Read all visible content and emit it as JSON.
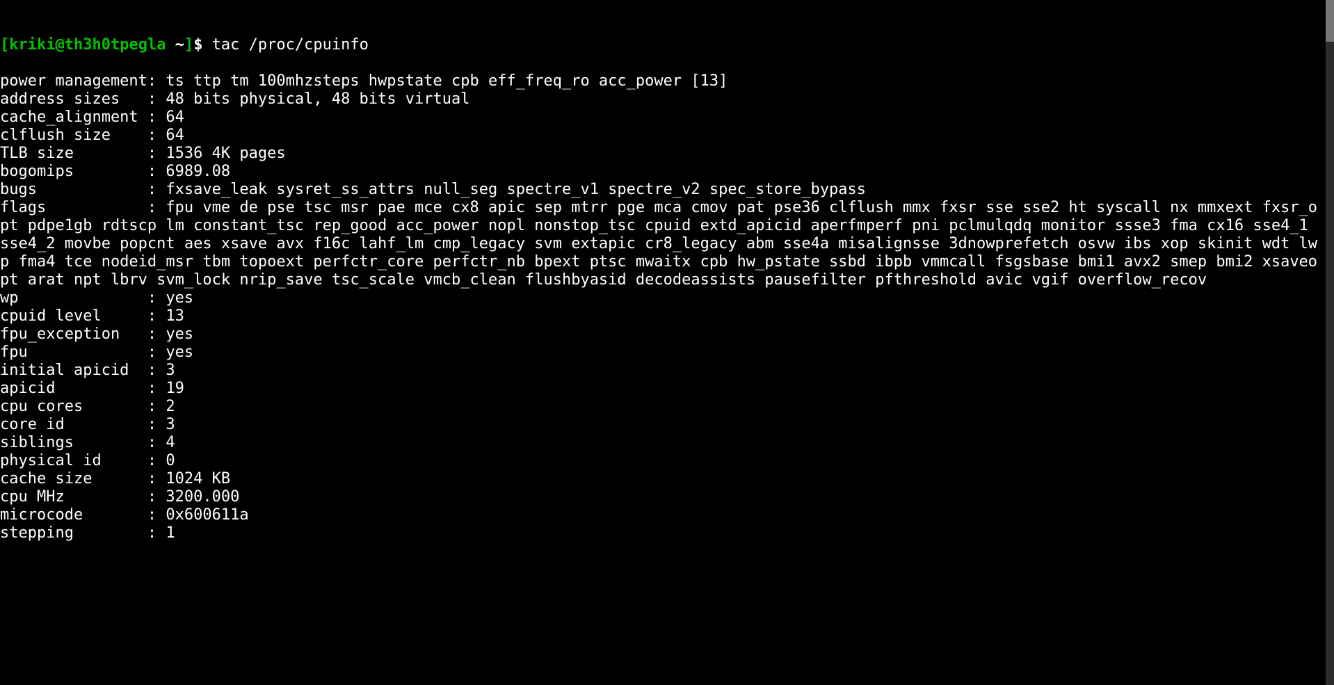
{
  "prompt": {
    "open": "[",
    "user": "kriki",
    "at": "@",
    "host": "th3h0tpegla",
    "space1": " ",
    "path": "~",
    "close": "]",
    "dollar": "$",
    "space2": " "
  },
  "command": "tac /proc/cpuinfo",
  "blank_after_command": "",
  "lines": [
    "power management: ts ttp tm 100mhzsteps hwpstate cpb eff_freq_ro acc_power [13]",
    "address sizes   : 48 bits physical, 48 bits virtual",
    "cache_alignment : 64",
    "clflush size    : 64",
    "TLB size        : 1536 4K pages",
    "bogomips        : 6989.08",
    "bugs            : fxsave_leak sysret_ss_attrs null_seg spectre_v1 spectre_v2 spec_store_bypass",
    "flags           : fpu vme de pse tsc msr pae mce cx8 apic sep mtrr pge mca cmov pat pse36 clflush mmx fxsr sse sse2 ht syscall nx mmxext fxsr_opt pdpe1gb rdtscp lm constant_tsc rep_good acc_power nopl nonstop_tsc cpuid extd_apicid aperfmperf pni pclmulqdq monitor ssse3 fma cx16 sse4_1 sse4_2 movbe popcnt aes xsave avx f16c lahf_lm cmp_legacy svm extapic cr8_legacy abm sse4a misalignsse 3dnowprefetch osvw ibs xop skinit wdt lwp fma4 tce nodeid_msr tbm topoext perfctr_core perfctr_nb bpext ptsc mwaitx cpb hw_pstate ssbd ibpb vmmcall fsgsbase bmi1 avx2 smep bmi2 xsaveopt arat npt lbrv svm_lock nrip_save tsc_scale vmcb_clean flushbyasid decodeassists pausefilter pfthreshold avic vgif overflow_recov",
    "wp              : yes",
    "cpuid level     : 13",
    "fpu_exception   : yes",
    "fpu             : yes",
    "initial apicid  : 3",
    "apicid          : 19",
    "cpu cores       : 2",
    "core id         : 3",
    "siblings        : 4",
    "physical id     : 0",
    "cache size      : 1024 KB",
    "cpu MHz         : 3200.000",
    "microcode       : 0x600611a",
    "stepping        : 1"
  ]
}
